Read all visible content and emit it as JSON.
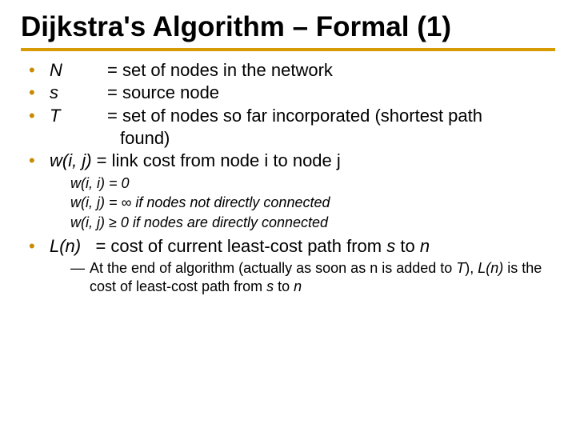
{
  "title": "Dijkstra's Algorithm – Formal (1)",
  "items": {
    "n": {
      "term": "N",
      "def": "= set of nodes in the network"
    },
    "s": {
      "term": "s",
      "def": "= source node"
    },
    "t": {
      "term": "T",
      "def1": "= set of nodes so far incorporated (shortest path",
      "def2": "found)"
    },
    "w": {
      "term": "w(i, j)",
      "def": "= link cost from node i to node j"
    },
    "l": {
      "term": "L(n)",
      "def_pre": "= cost of current least-cost path from ",
      "def_mid": "s",
      "def_mid2": " to ",
      "def_end": "n"
    }
  },
  "wsub": {
    "a": "w(i, i) = 0",
    "b": "w(i, j) = ∞ if nodes not directly connected",
    "c": "w(i, j) ≥ 0 if nodes are directly connected"
  },
  "lnote": {
    "a": "At the end of algorithm (actually as soon as n is added to ",
    "b": "T",
    "c": "), ",
    "d": "L(n)",
    "e": " is the cost of least-cost path from ",
    "f": "s",
    "g": " to ",
    "h": "n"
  }
}
